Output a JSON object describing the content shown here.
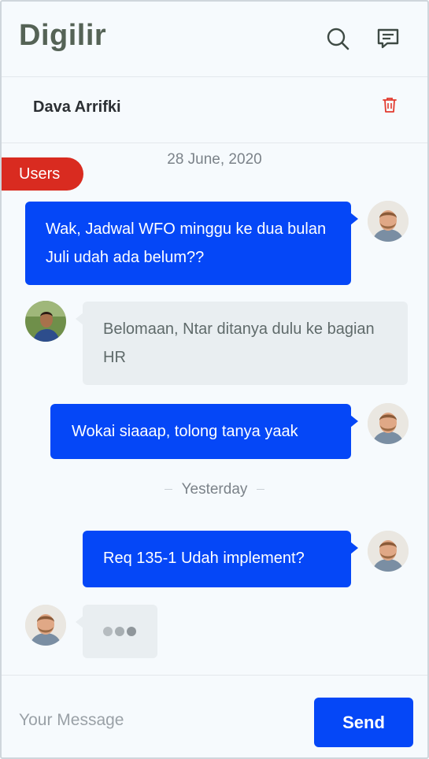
{
  "app": {
    "title": "Digilir"
  },
  "header": {
    "icons": [
      "search-icon",
      "chat-icon"
    ]
  },
  "contact": {
    "name": "Dava Arrifki",
    "delete_icon": "trash-icon"
  },
  "tag": {
    "label": "Users",
    "color": "#d92b20"
  },
  "dates": {
    "first": "28 June, 2020",
    "second": "Yesterday"
  },
  "messages": [
    {
      "direction": "out",
      "text": "Wak, Jadwal WFO minggu ke dua bulan Juli udah ada belum??"
    },
    {
      "direction": "in",
      "text": "Belomaan, Ntar ditanya dulu ke bagian HR"
    },
    {
      "direction": "out",
      "text": "Wokai siaaap, tolong tanya yaak"
    },
    {
      "direction": "out",
      "text": "Req 135-1 Udah implement?"
    },
    {
      "direction": "in",
      "typing": true
    }
  ],
  "composer": {
    "placeholder": "Your Message",
    "value": "",
    "send_label": "Send"
  },
  "colors": {
    "accent": "#0547f7",
    "incoming_bubble": "#e9eef1",
    "brand_text": "#556356",
    "danger": "#d92b20"
  }
}
